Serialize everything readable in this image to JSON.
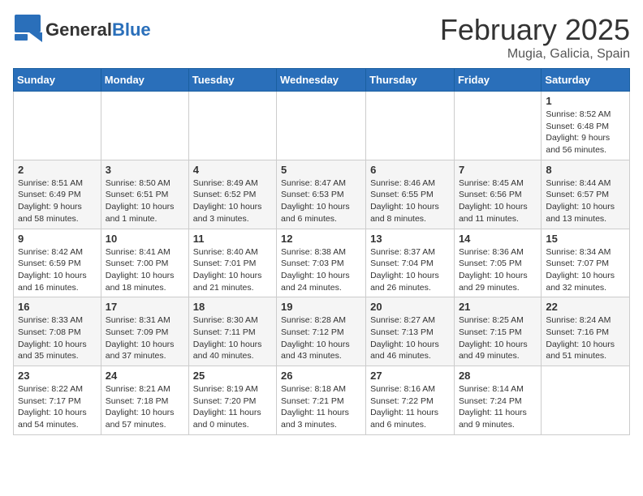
{
  "header": {
    "logo_general": "General",
    "logo_blue": "Blue",
    "month": "February 2025",
    "location": "Mugia, Galicia, Spain"
  },
  "days_of_week": [
    "Sunday",
    "Monday",
    "Tuesday",
    "Wednesday",
    "Thursday",
    "Friday",
    "Saturday"
  ],
  "weeks": [
    [
      {
        "day": "",
        "info": ""
      },
      {
        "day": "",
        "info": ""
      },
      {
        "day": "",
        "info": ""
      },
      {
        "day": "",
        "info": ""
      },
      {
        "day": "",
        "info": ""
      },
      {
        "day": "",
        "info": ""
      },
      {
        "day": "1",
        "info": "Sunrise: 8:52 AM\nSunset: 6:48 PM\nDaylight: 9 hours and 56 minutes."
      }
    ],
    [
      {
        "day": "2",
        "info": "Sunrise: 8:51 AM\nSunset: 6:49 PM\nDaylight: 9 hours and 58 minutes."
      },
      {
        "day": "3",
        "info": "Sunrise: 8:50 AM\nSunset: 6:51 PM\nDaylight: 10 hours and 1 minute."
      },
      {
        "day": "4",
        "info": "Sunrise: 8:49 AM\nSunset: 6:52 PM\nDaylight: 10 hours and 3 minutes."
      },
      {
        "day": "5",
        "info": "Sunrise: 8:47 AM\nSunset: 6:53 PM\nDaylight: 10 hours and 6 minutes."
      },
      {
        "day": "6",
        "info": "Sunrise: 8:46 AM\nSunset: 6:55 PM\nDaylight: 10 hours and 8 minutes."
      },
      {
        "day": "7",
        "info": "Sunrise: 8:45 AM\nSunset: 6:56 PM\nDaylight: 10 hours and 11 minutes."
      },
      {
        "day": "8",
        "info": "Sunrise: 8:44 AM\nSunset: 6:57 PM\nDaylight: 10 hours and 13 minutes."
      }
    ],
    [
      {
        "day": "9",
        "info": "Sunrise: 8:42 AM\nSunset: 6:59 PM\nDaylight: 10 hours and 16 minutes."
      },
      {
        "day": "10",
        "info": "Sunrise: 8:41 AM\nSunset: 7:00 PM\nDaylight: 10 hours and 18 minutes."
      },
      {
        "day": "11",
        "info": "Sunrise: 8:40 AM\nSunset: 7:01 PM\nDaylight: 10 hours and 21 minutes."
      },
      {
        "day": "12",
        "info": "Sunrise: 8:38 AM\nSunset: 7:03 PM\nDaylight: 10 hours and 24 minutes."
      },
      {
        "day": "13",
        "info": "Sunrise: 8:37 AM\nSunset: 7:04 PM\nDaylight: 10 hours and 26 minutes."
      },
      {
        "day": "14",
        "info": "Sunrise: 8:36 AM\nSunset: 7:05 PM\nDaylight: 10 hours and 29 minutes."
      },
      {
        "day": "15",
        "info": "Sunrise: 8:34 AM\nSunset: 7:07 PM\nDaylight: 10 hours and 32 minutes."
      }
    ],
    [
      {
        "day": "16",
        "info": "Sunrise: 8:33 AM\nSunset: 7:08 PM\nDaylight: 10 hours and 35 minutes."
      },
      {
        "day": "17",
        "info": "Sunrise: 8:31 AM\nSunset: 7:09 PM\nDaylight: 10 hours and 37 minutes."
      },
      {
        "day": "18",
        "info": "Sunrise: 8:30 AM\nSunset: 7:11 PM\nDaylight: 10 hours and 40 minutes."
      },
      {
        "day": "19",
        "info": "Sunrise: 8:28 AM\nSunset: 7:12 PM\nDaylight: 10 hours and 43 minutes."
      },
      {
        "day": "20",
        "info": "Sunrise: 8:27 AM\nSunset: 7:13 PM\nDaylight: 10 hours and 46 minutes."
      },
      {
        "day": "21",
        "info": "Sunrise: 8:25 AM\nSunset: 7:15 PM\nDaylight: 10 hours and 49 minutes."
      },
      {
        "day": "22",
        "info": "Sunrise: 8:24 AM\nSunset: 7:16 PM\nDaylight: 10 hours and 51 minutes."
      }
    ],
    [
      {
        "day": "23",
        "info": "Sunrise: 8:22 AM\nSunset: 7:17 PM\nDaylight: 10 hours and 54 minutes."
      },
      {
        "day": "24",
        "info": "Sunrise: 8:21 AM\nSunset: 7:18 PM\nDaylight: 10 hours and 57 minutes."
      },
      {
        "day": "25",
        "info": "Sunrise: 8:19 AM\nSunset: 7:20 PM\nDaylight: 11 hours and 0 minutes."
      },
      {
        "day": "26",
        "info": "Sunrise: 8:18 AM\nSunset: 7:21 PM\nDaylight: 11 hours and 3 minutes."
      },
      {
        "day": "27",
        "info": "Sunrise: 8:16 AM\nSunset: 7:22 PM\nDaylight: 11 hours and 6 minutes."
      },
      {
        "day": "28",
        "info": "Sunrise: 8:14 AM\nSunset: 7:24 PM\nDaylight: 11 hours and 9 minutes."
      },
      {
        "day": "",
        "info": ""
      }
    ]
  ]
}
